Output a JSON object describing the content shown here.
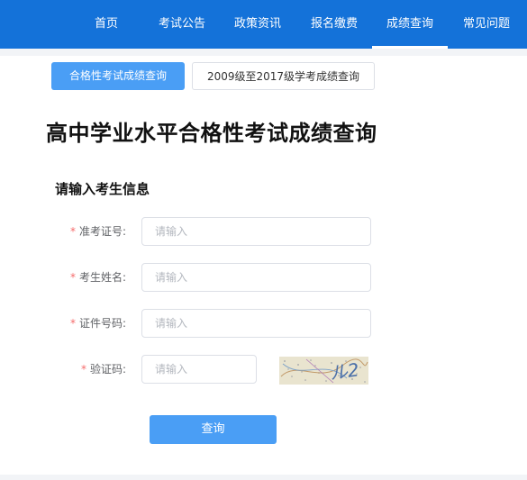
{
  "nav": {
    "items": [
      {
        "label": "首页"
      },
      {
        "label": "考试公告"
      },
      {
        "label": "政策资讯"
      },
      {
        "label": "报名缴费"
      },
      {
        "label": "成绩查询",
        "active": true
      },
      {
        "label": "常见问题"
      }
    ]
  },
  "tabs": [
    {
      "label": "合格性考试成绩查询",
      "active": true
    },
    {
      "label": "2009级至2017级学考成绩查询",
      "active": false
    }
  ],
  "page_title": "高中学业水平合格性考试成绩查询",
  "section_title": "请输入考生信息",
  "form": {
    "fields": [
      {
        "required_mark": "*",
        "label": "准考证号:",
        "placeholder": "请输入",
        "value": ""
      },
      {
        "required_mark": "*",
        "label": "考生姓名:",
        "placeholder": "请输入",
        "value": ""
      },
      {
        "required_mark": "*",
        "label": "证件号码:",
        "placeholder": "请输入",
        "value": ""
      },
      {
        "required_mark": "*",
        "label": "验证码:",
        "placeholder": "请输入",
        "value": ""
      }
    ],
    "captcha_text": "ル2",
    "submit_label": "查询"
  },
  "colors": {
    "nav_bg": "#1472d9",
    "primary": "#4a9ef5",
    "required": "#f56c6c"
  }
}
